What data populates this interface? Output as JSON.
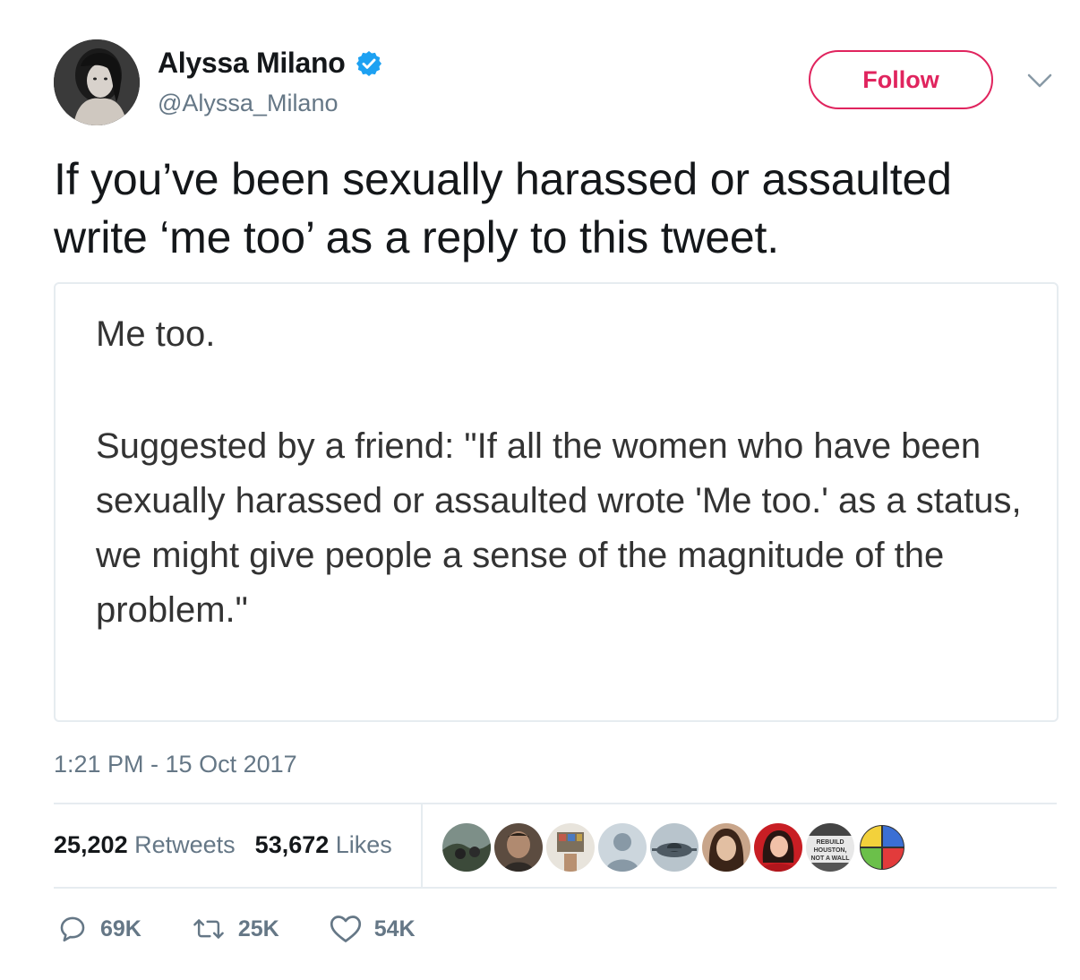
{
  "author": {
    "display_name": "Alyssa Milano",
    "handle": "@Alyssa_Milano",
    "verified_icon": "verified-badge-icon",
    "avatar_icon": "avatar"
  },
  "header": {
    "follow_label": "Follow",
    "menu_icon": "chevron-down-icon"
  },
  "tweet": {
    "text_line_1": "If you’ve been sexually harassed or assaulted",
    "text_line_2": "write ‘me too’ as a reply to this tweet."
  },
  "media": {
    "line_1": "Me too.",
    "paragraph": "Suggested by a friend: \"If all the women who have been sexually harassed or assaulted wrote 'Me too.' as a status, we might give people a sense of the magnitude of the problem.\""
  },
  "timestamp": "1:21 PM - 15 Oct 2017",
  "stats": {
    "retweets_count": "25,202",
    "retweets_label": "Retweets",
    "likes_count": "53,672",
    "likes_label": "Likes"
  },
  "likers": [
    {
      "id": "liker-1",
      "color": "#6b7d6a",
      "ground": "#3c4a3a"
    },
    {
      "id": "liker-2",
      "color": "#2f2a26",
      "ground": "#5c4c40"
    },
    {
      "id": "liker-3",
      "color": "#b89070",
      "ground": "#7c6f5c"
    },
    {
      "id": "liker-4",
      "color": "#ccd6dd",
      "ground": "#8899a6"
    },
    {
      "id": "liker-5",
      "color": "#8a9aa6",
      "ground": "#4e5a63"
    },
    {
      "id": "liker-6",
      "color": "#5a3a2a",
      "ground": "#c8a58a"
    },
    {
      "id": "liker-7",
      "color": "#c81e24",
      "ground": "#f2c1a8"
    },
    {
      "id": "liker-8",
      "color": "#444444",
      "ground": "#e8e8e8",
      "badge_text": "REBUILD HOUSTON, NOT A WALL"
    },
    {
      "id": "liker-9",
      "color": "#f3d13b",
      "ground": "#ffffff"
    }
  ],
  "actions": {
    "reply_icon": "reply-icon",
    "reply_count": "69K",
    "retweet_icon": "retweet-icon",
    "retweet_count": "25K",
    "like_icon": "heart-icon",
    "like_count": "54K"
  },
  "colors": {
    "follow_accent": "#e0245e",
    "verified_blue": "#1da1f2",
    "muted_text": "#657786",
    "divider": "#e6ecf0"
  }
}
